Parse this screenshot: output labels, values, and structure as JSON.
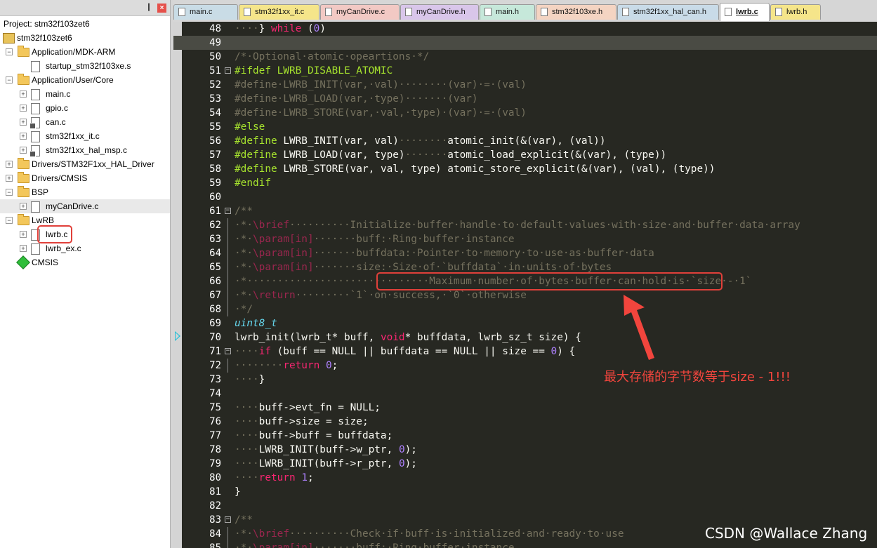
{
  "panel": {
    "pin_glyph": "❙",
    "close_glyph": "×",
    "project_title": "Project: stm32f103zet6"
  },
  "tree": [
    {
      "label": "stm32f103zet6",
      "kind": "project",
      "depth": 0,
      "expander": ""
    },
    {
      "label": "Application/MDK-ARM",
      "kind": "folder",
      "depth": 1,
      "expander": "−"
    },
    {
      "label": "startup_stm32f103xe.s",
      "kind": "file",
      "depth": 2,
      "expander": ""
    },
    {
      "label": "Application/User/Core",
      "kind": "folder",
      "depth": 1,
      "expander": "−"
    },
    {
      "label": "main.c",
      "kind": "file",
      "depth": 2,
      "expander": "+"
    },
    {
      "label": "gpio.c",
      "kind": "file",
      "depth": 2,
      "expander": "+"
    },
    {
      "label": "can.c",
      "kind": "file-dep",
      "depth": 2,
      "expander": "+"
    },
    {
      "label": "stm32f1xx_it.c",
      "kind": "file",
      "depth": 2,
      "expander": "+"
    },
    {
      "label": "stm32f1xx_hal_msp.c",
      "kind": "file-dep",
      "depth": 2,
      "expander": "+"
    },
    {
      "label": "Drivers/STM32F1xx_HAL_Driver",
      "kind": "folder",
      "depth": 1,
      "expander": "+"
    },
    {
      "label": "Drivers/CMSIS",
      "kind": "folder",
      "depth": 1,
      "expander": "+"
    },
    {
      "label": "BSP",
      "kind": "folder",
      "depth": 1,
      "expander": "−"
    },
    {
      "label": "myCanDrive.c",
      "kind": "file",
      "depth": 2,
      "expander": "+",
      "selected": true
    },
    {
      "label": "LwRB",
      "kind": "folder",
      "depth": 1,
      "expander": "−"
    },
    {
      "label": "lwrb.c",
      "kind": "file",
      "depth": 2,
      "expander": "+"
    },
    {
      "label": "lwrb_ex.c",
      "kind": "file",
      "depth": 2,
      "expander": "+"
    },
    {
      "label": "CMSIS",
      "kind": "cmsis",
      "depth": 1,
      "expander": ""
    }
  ],
  "tabs": [
    {
      "label": "main.c",
      "color": "#c9dce6",
      "width": 92
    },
    {
      "label": "stm32f1xx_it.c",
      "color": "#f5e58a",
      "width": 115
    },
    {
      "label": "myCanDrive.c",
      "color": "#f2c9c4",
      "width": 113
    },
    {
      "label": "myCanDrive.h",
      "color": "#d9c6ea",
      "width": 112
    },
    {
      "label": "main.h",
      "color": "#c6e8da",
      "width": 79
    },
    {
      "label": "stm32f103xe.h",
      "color": "#f4d4c2",
      "width": 115
    },
    {
      "label": "stm32f1xx_hal_can.h",
      "color": "#c9dbe8",
      "width": 145
    },
    {
      "label": "lwrb.c",
      "color": "#ffffff",
      "width": 71,
      "active": true
    },
    {
      "label": "lwrb.h",
      "color": "#f5e58a",
      "width": 72
    }
  ],
  "code_lines": [
    {
      "n": "48",
      "html": "<span class=\"c\">····</span><span class=\"w\">} </span><span class=\"k\">while</span><span class=\"w\"> (</span><span class=\"n\">0</span><span class=\"w\">)</span>"
    },
    {
      "n": "49",
      "html": "",
      "current": true
    },
    {
      "n": "50",
      "html": "<span class=\"c\">/*·Optional·atomic·opeartions·*/</span>"
    },
    {
      "n": "51",
      "fold": "−",
      "html": "<span class=\"p\">#ifdef LWRB_DISABLE_ATOMIC</span>"
    },
    {
      "n": "52",
      "html": "<span class=\"c\">#define·LWRB_INIT(var,·val)········(var)·=·(val)</span>"
    },
    {
      "n": "53",
      "html": "<span class=\"c\">#define·LWRB_LOAD(var,·type)·······(var)</span>"
    },
    {
      "n": "54",
      "html": "<span class=\"c\">#define·LWRB_STORE(var,·val,·type)·(var)·=·(val)</span>"
    },
    {
      "n": "55",
      "html": "<span class=\"p\">#else</span>"
    },
    {
      "n": "56",
      "html": "<span class=\"p\">#define</span><span class=\"w\"> LWRB_INIT(var, val)</span><span class=\"c\">········</span><span class=\"w\">atomic_init(&amp;(var), (val))</span>"
    },
    {
      "n": "57",
      "html": "<span class=\"p\">#define</span><span class=\"w\"> LWRB_LOAD(var, type)</span><span class=\"c\">·······</span><span class=\"w\">atomic_load_explicit(&amp;(var), (type))</span>"
    },
    {
      "n": "58",
      "html": "<span class=\"p\">#define</span><span class=\"w\"> LWRB_STORE(var, val, type) atomic_store_explicit(&amp;(var), (val), (type))</span>"
    },
    {
      "n": "59",
      "html": "<span class=\"p\">#endif</span>"
    },
    {
      "n": "60",
      "html": ""
    },
    {
      "n": "61",
      "fold": "−",
      "html": "<span class=\"c\">/**</span>"
    },
    {
      "n": "62",
      "foldline": true,
      "html": "<span class=\"c\">·*·</span><span class=\"k\" style=\"opacity:.55\">\\brief</span><span class=\"c\">··········Initialize·buffer·handle·to·default·values·with·size·and·buffer·data·array</span>"
    },
    {
      "n": "63",
      "foldline": true,
      "html": "<span class=\"c\">·*·</span><span class=\"k\" style=\"opacity:.55\">\\param[in]</span><span class=\"c\">·······buff:·Ring·buffer·instance</span>"
    },
    {
      "n": "64",
      "foldline": true,
      "html": "<span class=\"c\">·*·</span><span class=\"k\" style=\"opacity:.55\">\\param[in]</span><span class=\"c\">·······buffdata:·Pointer·to·memory·to·use·as·buffer·data</span>"
    },
    {
      "n": "65",
      "foldline": true,
      "html": "<span class=\"c\">·*·</span><span class=\"k\" style=\"opacity:.55\">\\param[in]</span><span class=\"c\">·······size:·Size·of·`buffdata`·in·units·of·bytes</span>"
    },
    {
      "n": "66",
      "foldline": true,
      "html": "<span class=\"c\">·*······························Maximum·number·of·bytes·buffer·can·hold·is·`size·-·1`</span>"
    },
    {
      "n": "67",
      "foldline": true,
      "html": "<span class=\"c\">·*·</span><span class=\"k\" style=\"opacity:.55\">\\return</span><span class=\"c\">·········`1`·on·success,·`0`·otherwise</span>"
    },
    {
      "n": "68",
      "foldline": true,
      "html": "<span class=\"c\">·*/</span>"
    },
    {
      "n": "69",
      "html": "<span class=\"t\">uint8_t</span>"
    },
    {
      "n": "70",
      "html": "<span class=\"w\">lwrb_init(lwrb_t* buff, </span><span class=\"k\">void</span><span class=\"w\">* buffdata, lwrb_sz_t size) {</span>"
    },
    {
      "n": "71",
      "fold": "−",
      "html": "<span class=\"c\">····</span><span class=\"k\">if</span><span class=\"w\"> (buff == NULL || buffdata == NULL || size == </span><span class=\"n\">0</span><span class=\"w\">) {</span>"
    },
    {
      "n": "72",
      "foldline": true,
      "html": "<span class=\"c\">········</span><span class=\"k\">return</span><span class=\"w\"> </span><span class=\"n\">0</span><span class=\"w\">;</span>"
    },
    {
      "n": "73",
      "html": "<span class=\"c\">····</span><span class=\"w\">}</span>"
    },
    {
      "n": "74",
      "html": ""
    },
    {
      "n": "75",
      "html": "<span class=\"c\">····</span><span class=\"w\">buff-&gt;evt_fn = NULL;</span>"
    },
    {
      "n": "76",
      "html": "<span class=\"c\">····</span><span class=\"w\">buff-&gt;size = size;</span>"
    },
    {
      "n": "77",
      "html": "<span class=\"c\">····</span><span class=\"w\">buff-&gt;buff = buffdata;</span>"
    },
    {
      "n": "78",
      "html": "<span class=\"c\">····</span><span class=\"w\">LWRB_INIT(buff-&gt;w_ptr, </span><span class=\"n\">0</span><span class=\"w\">);</span>"
    },
    {
      "n": "79",
      "html": "<span class=\"c\">····</span><span class=\"w\">LWRB_INIT(buff-&gt;r_ptr, </span><span class=\"n\">0</span><span class=\"w\">);</span>"
    },
    {
      "n": "80",
      "html": "<span class=\"c\">····</span><span class=\"k\">return</span><span class=\"w\"> </span><span class=\"n\">1</span><span class=\"w\">;</span>"
    },
    {
      "n": "81",
      "html": "<span class=\"w\">}</span>"
    },
    {
      "n": "82",
      "html": ""
    },
    {
      "n": "83",
      "fold": "−",
      "html": "<span class=\"c\">/**</span>"
    },
    {
      "n": "84",
      "foldline": true,
      "html": "<span class=\"c\">·*·</span><span class=\"k\" style=\"opacity:.55\">\\brief</span><span class=\"c\">··········Check·if·buff·is·initialized·and·ready·to·use</span>"
    },
    {
      "n": "85",
      "foldline": true,
      "html": "<span class=\"c\">·*·</span><span class=\"k\" style=\"opacity:.55\">\\param[in]</span><span class=\"c\">·······buff:·Ring·buffer·instance</span>"
    }
  ],
  "annotation": {
    "text": "最大存储的字节数等于size - 1!!!",
    "color": "#f2453d"
  },
  "watermark": "CSDN @Wallace Zhang",
  "colors": {
    "editor_bg": "#272822",
    "keyword": "#f92672",
    "number": "#ae81ff",
    "comment": "#75715e",
    "preprocessor": "#a6e22e",
    "type": "#66d9ef",
    "highlight_red": "#e0403a"
  }
}
